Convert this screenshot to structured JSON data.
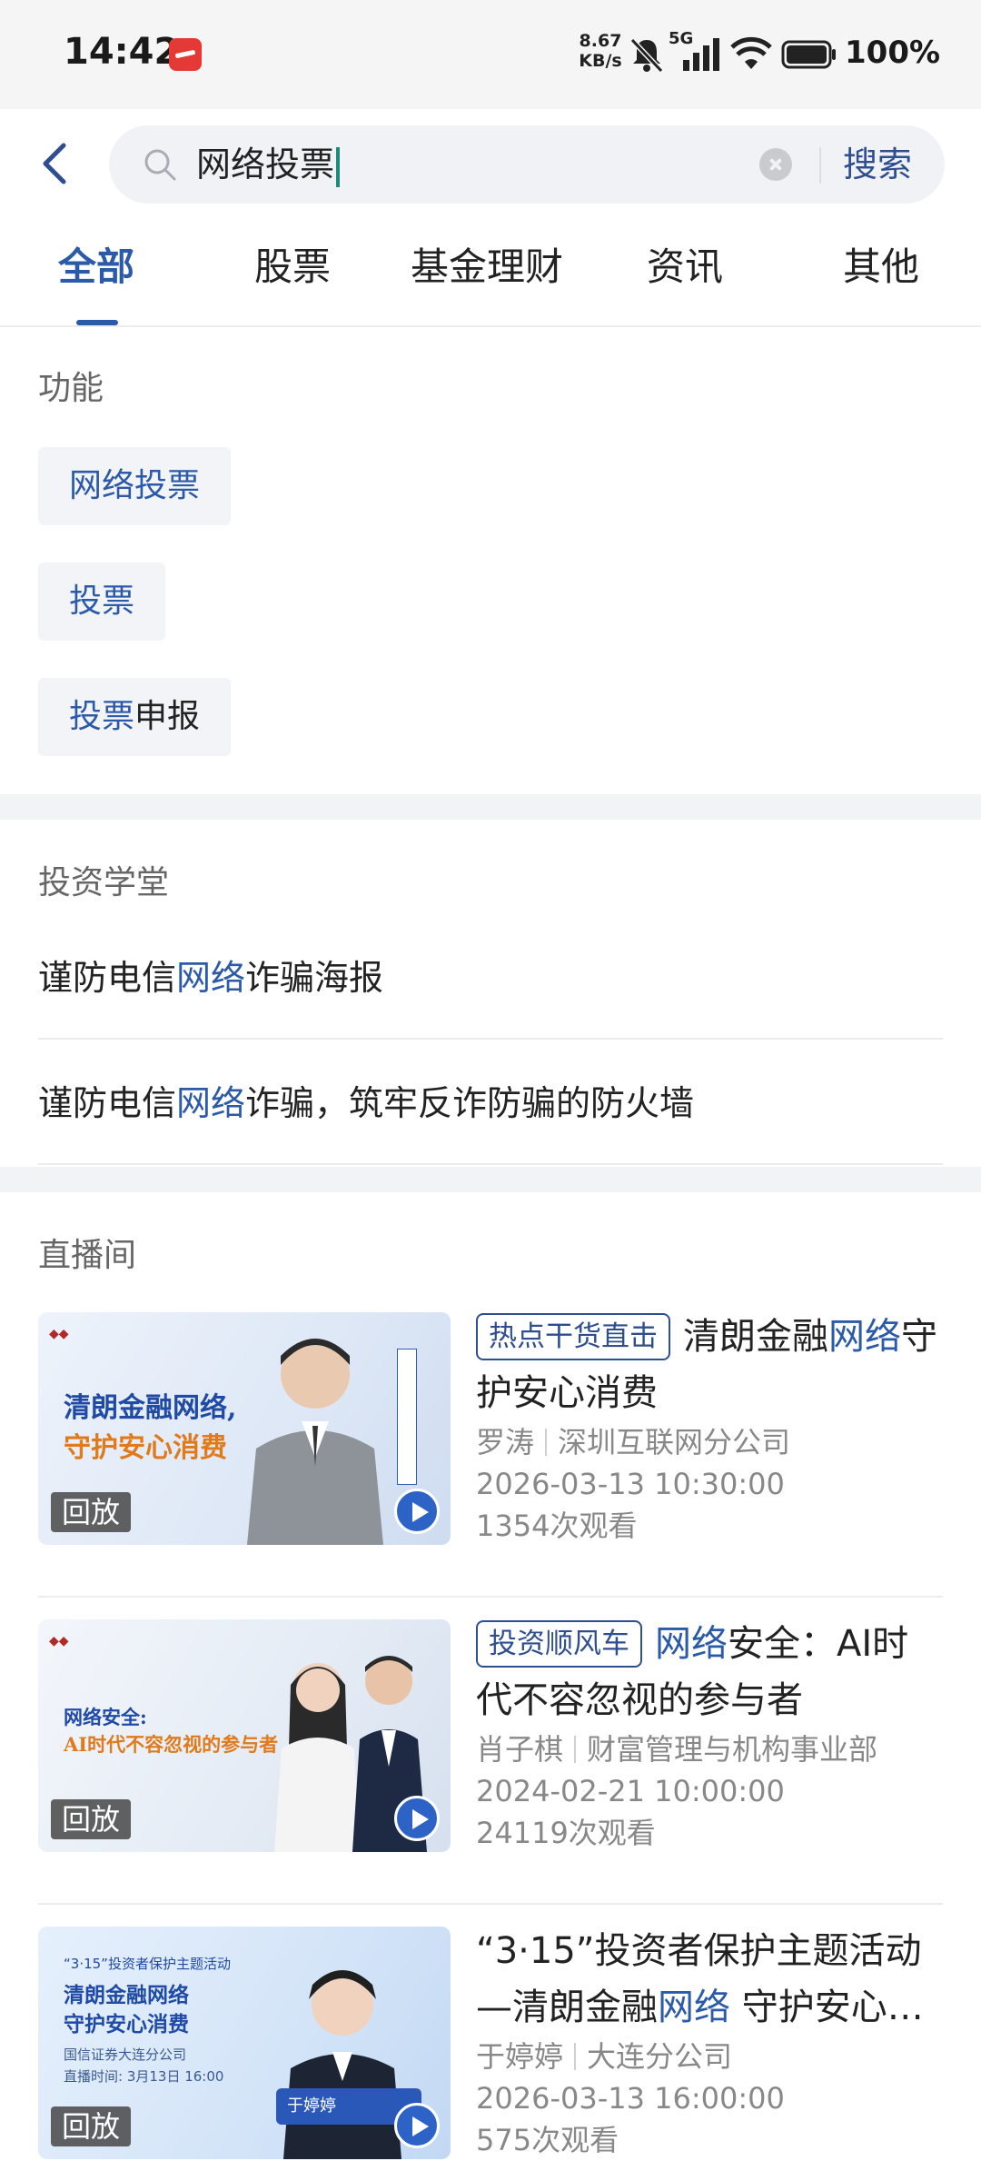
{
  "status_bar": {
    "time": "14:42",
    "net_speed": "8.67",
    "net_speed_unit": "KB/s",
    "network": "5G",
    "battery": "100%",
    "icons": [
      "app-notification-icon",
      "mute-bell-icon",
      "signal-icon",
      "wifi-icon",
      "battery-icon"
    ]
  },
  "search": {
    "query": "网络投票",
    "button": "搜索"
  },
  "tabs": [
    "全部",
    "股票",
    "基金理财",
    "资讯",
    "其他"
  ],
  "active_tab": "全部",
  "functions": {
    "title": "功能",
    "chips": [
      {
        "hl": "网络投票",
        "rest": ""
      },
      {
        "hl": "投票",
        "rest": ""
      },
      {
        "hl": "投票",
        "rest": "申报"
      }
    ]
  },
  "school": {
    "title": "投资学堂",
    "articles": [
      {
        "pre": "谨防电信",
        "hl": "网络",
        "post": "诈骗海报"
      },
      {
        "pre": "谨防电信",
        "hl": "网络",
        "post": "诈骗，筑牢反诈防骗的防火墙"
      }
    ]
  },
  "live": {
    "title": "直播间",
    "items": [
      {
        "tag": "热点干货直击",
        "title_pre": "清朗金融",
        "title_hl": "网络",
        "title_post": "守护安心消费",
        "host": "罗涛",
        "dept": "深圳互联网分公司",
        "datetime": "2026-03-13 10:30:00",
        "views": "1354次观看",
        "badge": "回放",
        "thumb_line1": "清朗金融网络,",
        "thumb_line2": "守护安心消费"
      },
      {
        "tag": "投资顺风车",
        "title_pre": "",
        "title_hl": "网络",
        "title_post": "安全：AI时代不容忽视的参与者",
        "host": "肖子棋",
        "dept": "财富管理与机构事业部",
        "datetime": "2024-02-21 10:00:00",
        "views": "24119次观看",
        "badge": "回放",
        "thumb_line1": "网络安全:",
        "thumb_line2": "AI时代不容忽视的参与者"
      },
      {
        "tag": "",
        "title_pre": "“3·15”投资者保护主题活动—清朗金融",
        "title_hl": "网络",
        "title_post": " 守护安心…",
        "host": "于婷婷",
        "dept": "大连分公司",
        "datetime": "2026-03-13 16:00:00",
        "views": "575次观看",
        "badge": "回放",
        "thumb_line1": "清朗金融网络",
        "thumb_line2": "守护安心消费",
        "thumb_top": "“3·15”投资者保护主题活动",
        "thumb_sub1": "国信证券大连分公司",
        "thumb_sub2": "直播时间: 3月13日 16:00",
        "thumb_name": "于婷婷"
      }
    ]
  },
  "colors": {
    "accent": "#2b5aa8",
    "tag_border": "#2e4e8f",
    "caret": "#1f8a78"
  }
}
